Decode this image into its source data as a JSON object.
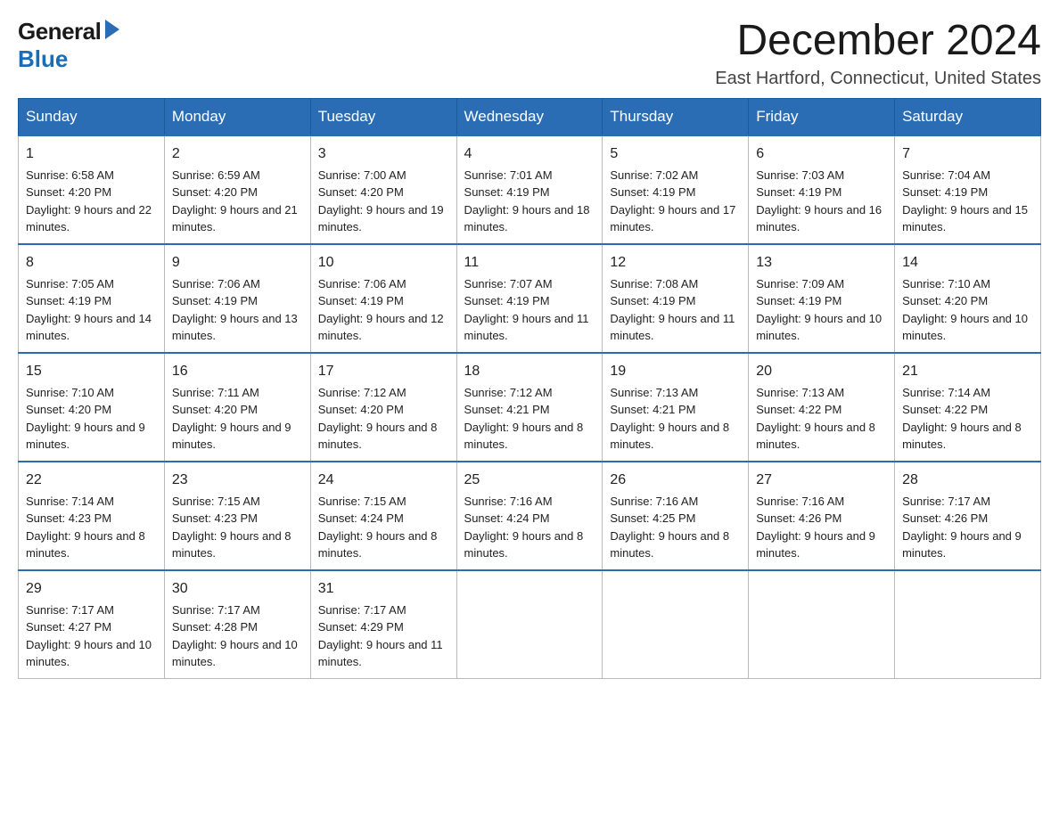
{
  "header": {
    "logo": {
      "general": "General",
      "blue": "Blue",
      "arrow_unicode": "▶"
    },
    "title": "December 2024",
    "location": "East Hartford, Connecticut, United States"
  },
  "calendar": {
    "days_of_week": [
      "Sunday",
      "Monday",
      "Tuesday",
      "Wednesday",
      "Thursday",
      "Friday",
      "Saturday"
    ],
    "weeks": [
      [
        {
          "day": "1",
          "sunrise": "6:58 AM",
          "sunset": "4:20 PM",
          "daylight": "9 hours and 22 minutes."
        },
        {
          "day": "2",
          "sunrise": "6:59 AM",
          "sunset": "4:20 PM",
          "daylight": "9 hours and 21 minutes."
        },
        {
          "day": "3",
          "sunrise": "7:00 AM",
          "sunset": "4:20 PM",
          "daylight": "9 hours and 19 minutes."
        },
        {
          "day": "4",
          "sunrise": "7:01 AM",
          "sunset": "4:19 PM",
          "daylight": "9 hours and 18 minutes."
        },
        {
          "day": "5",
          "sunrise": "7:02 AM",
          "sunset": "4:19 PM",
          "daylight": "9 hours and 17 minutes."
        },
        {
          "day": "6",
          "sunrise": "7:03 AM",
          "sunset": "4:19 PM",
          "daylight": "9 hours and 16 minutes."
        },
        {
          "day": "7",
          "sunrise": "7:04 AM",
          "sunset": "4:19 PM",
          "daylight": "9 hours and 15 minutes."
        }
      ],
      [
        {
          "day": "8",
          "sunrise": "7:05 AM",
          "sunset": "4:19 PM",
          "daylight": "9 hours and 14 minutes."
        },
        {
          "day": "9",
          "sunrise": "7:06 AM",
          "sunset": "4:19 PM",
          "daylight": "9 hours and 13 minutes."
        },
        {
          "day": "10",
          "sunrise": "7:06 AM",
          "sunset": "4:19 PM",
          "daylight": "9 hours and 12 minutes."
        },
        {
          "day": "11",
          "sunrise": "7:07 AM",
          "sunset": "4:19 PM",
          "daylight": "9 hours and 11 minutes."
        },
        {
          "day": "12",
          "sunrise": "7:08 AM",
          "sunset": "4:19 PM",
          "daylight": "9 hours and 11 minutes."
        },
        {
          "day": "13",
          "sunrise": "7:09 AM",
          "sunset": "4:19 PM",
          "daylight": "9 hours and 10 minutes."
        },
        {
          "day": "14",
          "sunrise": "7:10 AM",
          "sunset": "4:20 PM",
          "daylight": "9 hours and 10 minutes."
        }
      ],
      [
        {
          "day": "15",
          "sunrise": "7:10 AM",
          "sunset": "4:20 PM",
          "daylight": "9 hours and 9 minutes."
        },
        {
          "day": "16",
          "sunrise": "7:11 AM",
          "sunset": "4:20 PM",
          "daylight": "9 hours and 9 minutes."
        },
        {
          "day": "17",
          "sunrise": "7:12 AM",
          "sunset": "4:20 PM",
          "daylight": "9 hours and 8 minutes."
        },
        {
          "day": "18",
          "sunrise": "7:12 AM",
          "sunset": "4:21 PM",
          "daylight": "9 hours and 8 minutes."
        },
        {
          "day": "19",
          "sunrise": "7:13 AM",
          "sunset": "4:21 PM",
          "daylight": "9 hours and 8 minutes."
        },
        {
          "day": "20",
          "sunrise": "7:13 AM",
          "sunset": "4:22 PM",
          "daylight": "9 hours and 8 minutes."
        },
        {
          "day": "21",
          "sunrise": "7:14 AM",
          "sunset": "4:22 PM",
          "daylight": "9 hours and 8 minutes."
        }
      ],
      [
        {
          "day": "22",
          "sunrise": "7:14 AM",
          "sunset": "4:23 PM",
          "daylight": "9 hours and 8 minutes."
        },
        {
          "day": "23",
          "sunrise": "7:15 AM",
          "sunset": "4:23 PM",
          "daylight": "9 hours and 8 minutes."
        },
        {
          "day": "24",
          "sunrise": "7:15 AM",
          "sunset": "4:24 PM",
          "daylight": "9 hours and 8 minutes."
        },
        {
          "day": "25",
          "sunrise": "7:16 AM",
          "sunset": "4:24 PM",
          "daylight": "9 hours and 8 minutes."
        },
        {
          "day": "26",
          "sunrise": "7:16 AM",
          "sunset": "4:25 PM",
          "daylight": "9 hours and 8 minutes."
        },
        {
          "day": "27",
          "sunrise": "7:16 AM",
          "sunset": "4:26 PM",
          "daylight": "9 hours and 9 minutes."
        },
        {
          "day": "28",
          "sunrise": "7:17 AM",
          "sunset": "4:26 PM",
          "daylight": "9 hours and 9 minutes."
        }
      ],
      [
        {
          "day": "29",
          "sunrise": "7:17 AM",
          "sunset": "4:27 PM",
          "daylight": "9 hours and 10 minutes."
        },
        {
          "day": "30",
          "sunrise": "7:17 AM",
          "sunset": "4:28 PM",
          "daylight": "9 hours and 10 minutes."
        },
        {
          "day": "31",
          "sunrise": "7:17 AM",
          "sunset": "4:29 PM",
          "daylight": "9 hours and 11 minutes."
        },
        null,
        null,
        null,
        null
      ]
    ]
  }
}
